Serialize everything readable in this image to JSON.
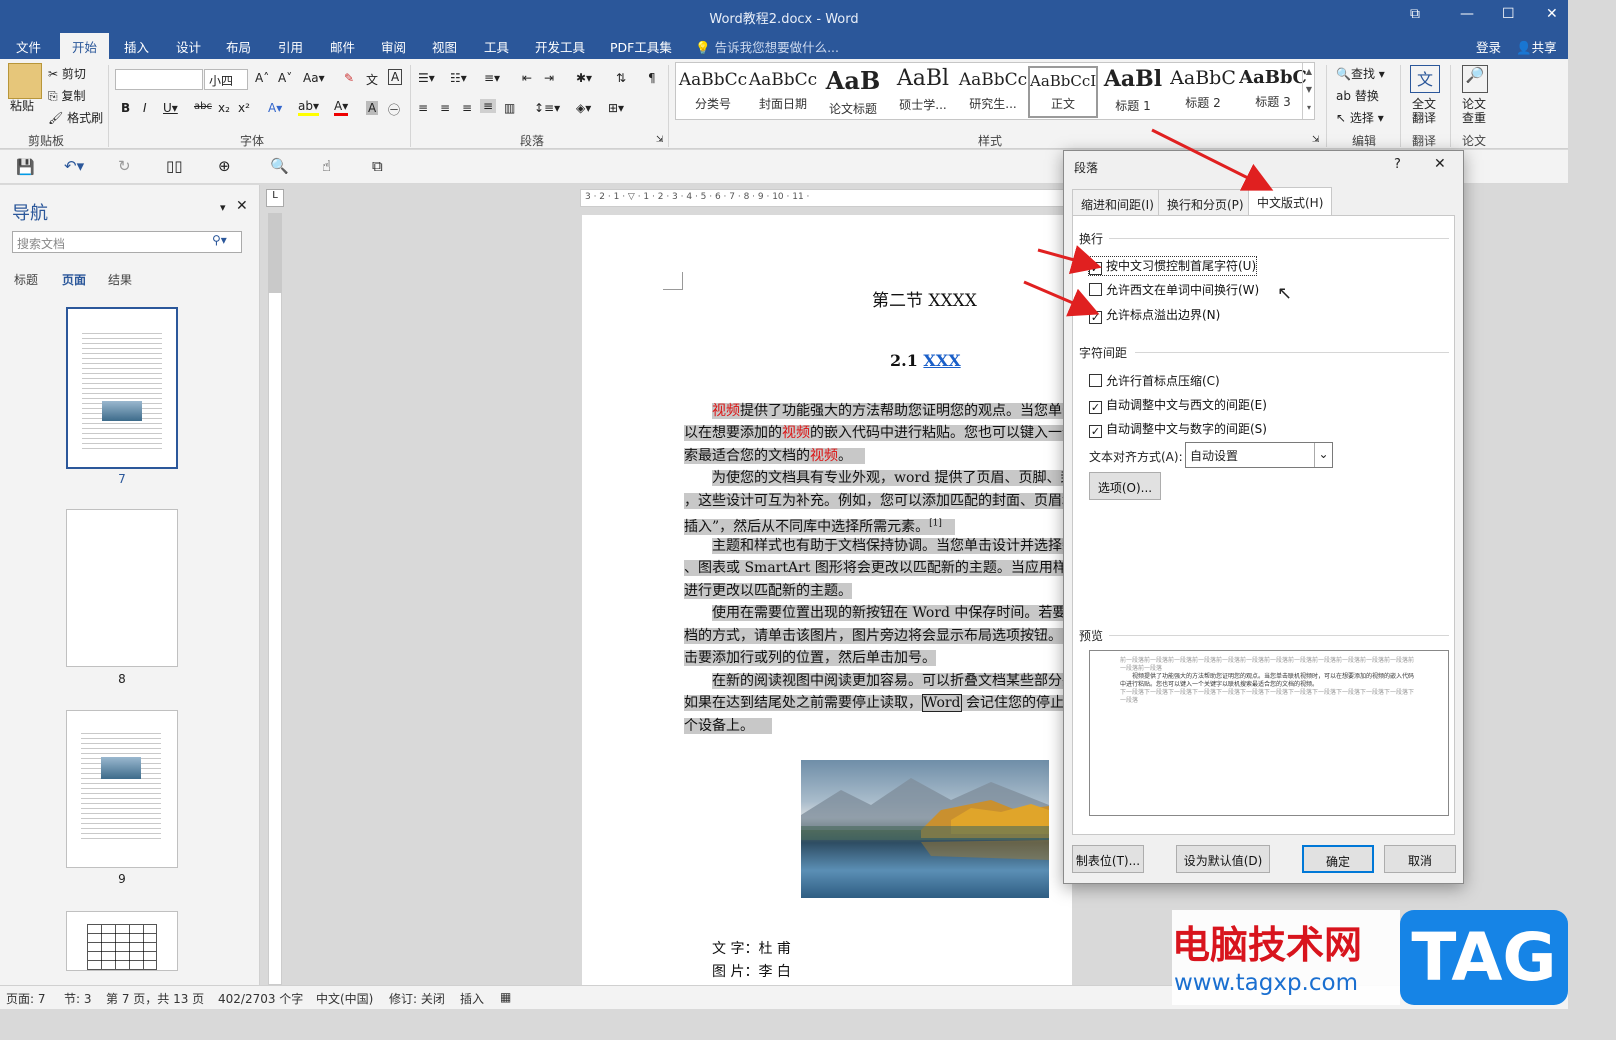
{
  "window": {
    "title": "Word教程2.docx - Word"
  },
  "ribbon_tabs": [
    "文件",
    "开始",
    "插入",
    "设计",
    "布局",
    "引用",
    "邮件",
    "审阅",
    "视图",
    "工具",
    "开发工具",
    "PDF工具集"
  ],
  "tell_me": "告诉我您想要做什么...",
  "account": {
    "login": "登录",
    "share": "共享"
  },
  "clipboard": {
    "paste": "粘贴",
    "cut": "剪切",
    "copy": "复制",
    "format_painter": "格式刷",
    "group": "剪贴板"
  },
  "font": {
    "name": "",
    "size": "小四",
    "group": "字体"
  },
  "paragraph_group": "段落",
  "styles": {
    "group": "样式",
    "items": [
      {
        "sample": "AaBbCc",
        "name": "分类号"
      },
      {
        "sample": "AaBbCc",
        "name": "封面日期"
      },
      {
        "sample": "AaB",
        "name": "论文标题"
      },
      {
        "sample": "AaBl",
        "name": "硕士学..."
      },
      {
        "sample": "AaBbCc",
        "name": "研究生..."
      },
      {
        "sample": "AaBbCcI",
        "name": "正文"
      },
      {
        "sample": "AaBl",
        "name": "标题 1"
      },
      {
        "sample": "AaBbC",
        "name": "标题 2"
      },
      {
        "sample": "AaBbC",
        "name": "标题 3"
      }
    ]
  },
  "editing": {
    "find": "查找",
    "replace": "替换",
    "select": "选择",
    "group": "编辑"
  },
  "translate": {
    "label": "全文\n翻译",
    "group": "翻译"
  },
  "paper": {
    "label": "论文\n查重",
    "group": "论文"
  },
  "nav": {
    "title": "导航",
    "search_placeholder": "搜索文档",
    "tabs": [
      "标题",
      "页面",
      "结果"
    ],
    "pages": [
      "7",
      "8",
      "9"
    ]
  },
  "document": {
    "heading": "第二节  XXXX",
    "subheading_num": "2.1",
    "subheading_link": "XXX",
    "lines": [
      [
        "视频",
        "提供了功能强大的方法帮助您证明您的观点。当您单击"
      ],
      [
        "以在想要添加的",
        "视频",
        "的嵌入代码中进行粘贴。您也可以键入一个"
      ],
      [
        "索最适合您的文档的",
        "视频",
        "。"
      ],
      [
        "为使您的文档具有专业外观，word 提供了页眉、页脚、封"
      ],
      [
        "，这些设计可互为补充。例如，您可以添加匹配的封面、页眉和"
      ],
      [
        "插入”，然后从不同库中选择所需元素。",
        "[1]"
      ],
      [
        "主题和样式也有助于文档保持协调。当您单击设计并选择新"
      ],
      [
        "、图表或 SmartArt 图形将会更改以匹配新的主题。当应用样式"
      ],
      [
        "进行更改以匹配新的主题。"
      ],
      [
        "使用在需要位置出现的新按钮在 Word 中保存时间。若要"
      ],
      [
        "档的方式，请单击该图片，图片旁边将会显示布局选项按钮。当"
      ],
      [
        "击要添加行或列的位置，然后单击加号。"
      ],
      [
        "在新的阅读视图中阅读更加容易。可以折叠文档某些部分并"
      ],
      [
        "如果在达到结尾处之前需要停止读取，",
        "Word",
        " 会记住您的停止位"
      ],
      [
        "个设备上。"
      ]
    ],
    "caption1_label": "文 字：",
    "caption1_value": "杜    甫",
    "caption2_label": "图 片：",
    "caption2_value": "李    白"
  },
  "dialog": {
    "title": "段落",
    "help": "?",
    "close": "✕",
    "tabs": [
      "缩进和间距(I)",
      "换行和分页(P)",
      "中文版式(H)"
    ],
    "section_wrap": "换行",
    "wrap_options": [
      {
        "label": "按中文习惯控制首尾字符(U)",
        "checked": true
      },
      {
        "label": "允许西文在单词中间换行(W)",
        "checked": false
      },
      {
        "label": "允许标点溢出边界(N)",
        "checked": true
      }
    ],
    "section_spacing": "字符间距",
    "spacing_options": [
      {
        "label": "允许行首标点压缩(C)",
        "checked": false
      },
      {
        "label": "自动调整中文与西文的间距(E)",
        "checked": true
      },
      {
        "label": "自动调整中文与数字的间距(S)",
        "checked": true
      }
    ],
    "align_label": "文本对齐方式(A):",
    "align_value": "自动设置",
    "options_button": "选项(O)...",
    "section_preview": "预览",
    "preview_prev": "前一段落前一段落前一段落前一段落前一段落前一段落前一段落前一段落前一段落前一段落前一段落前一段落前一段落前一段落",
    "preview_text": "视频提供了功能强大的方法帮助您证明您的观点。当您单击联机视频时，可以在想要添加的视频的嵌入代码中进行粘贴。您也可以键入一个关键字以联机搜索最适合您的文档的视频。",
    "preview_next": "下一段落下一段落下一段落下一段落下一段落下一段落下一段落下一段落下一段落下一段落下一段落下一段落下一段落",
    "buttons": {
      "tabs": "制表位(T)...",
      "default": "设为默认值(D)",
      "ok": "确定",
      "cancel": "取消"
    }
  },
  "status": {
    "page": "页面: 7",
    "section": "节: 3",
    "page_of": "第 7 页，共 13 页",
    "words": "402/2703 个字",
    "language": "中文(中国)",
    "track": "修订: 关闭",
    "insert": "插入"
  },
  "watermark": {
    "site_name": "电脑技术网",
    "url": "www.tagxp.com",
    "logo": "TAG"
  },
  "colors": {
    "brand": "#2b579a",
    "red_arrow": "#e02020",
    "highlight": "#c8c8c8"
  }
}
